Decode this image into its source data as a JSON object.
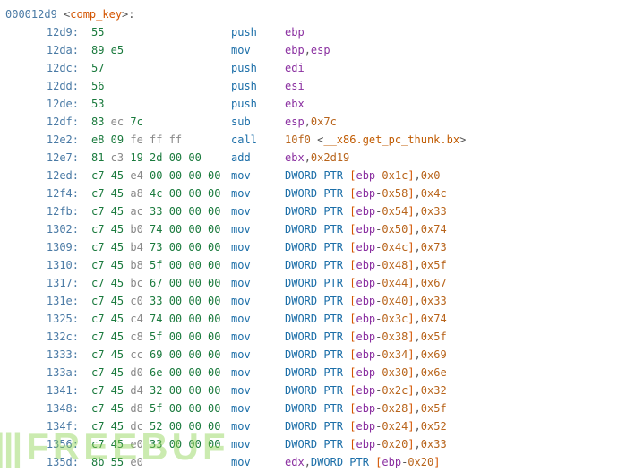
{
  "header": {
    "addr": "000012d9",
    "open": " <",
    "label": "comp_key",
    "close": ">:"
  },
  "rows": [
    {
      "addr": "12d9:",
      "bytes": [
        [
          "55",
          "h"
        ]
      ],
      "mnem": "push",
      "operands": [
        [
          "ebp",
          "reg"
        ]
      ]
    },
    {
      "addr": "12da:",
      "bytes": [
        [
          "89",
          "h"
        ],
        [
          " e5",
          "h"
        ]
      ],
      "mnem": "mov",
      "operands": [
        [
          "ebp",
          "reg"
        ],
        [
          ",",
          "punct"
        ],
        [
          "esp",
          "reg"
        ]
      ]
    },
    {
      "addr": "12dc:",
      "bytes": [
        [
          "57",
          "h"
        ]
      ],
      "mnem": "push",
      "operands": [
        [
          "edi",
          "reg"
        ]
      ]
    },
    {
      "addr": "12dd:",
      "bytes": [
        [
          "56",
          "h"
        ]
      ],
      "mnem": "push",
      "operands": [
        [
          "esi",
          "reg"
        ]
      ]
    },
    {
      "addr": "12de:",
      "bytes": [
        [
          "53",
          "h"
        ]
      ],
      "mnem": "push",
      "operands": [
        [
          "ebx",
          "reg"
        ]
      ]
    },
    {
      "addr": "12df:",
      "bytes": [
        [
          "83",
          "h"
        ],
        [
          " ec ",
          "m"
        ],
        [
          "7c",
          "h"
        ]
      ],
      "mnem": "sub",
      "operands": [
        [
          "esp",
          "reg"
        ],
        [
          ",",
          "punct"
        ],
        [
          "0x7c",
          "num"
        ]
      ]
    },
    {
      "addr": "12e2:",
      "bytes": [
        [
          "e8 09 ",
          "h"
        ],
        [
          "fe ff ff",
          "m"
        ]
      ],
      "mnem": "call",
      "operands": [
        [
          "10f0 ",
          "num"
        ],
        [
          "<",
          "punct"
        ],
        [
          "__x86.get_pc_thunk.bx",
          "str"
        ],
        [
          ">",
          "punct"
        ]
      ]
    },
    {
      "addr": "12e7:",
      "bytes": [
        [
          "81",
          "h"
        ],
        [
          " c3 ",
          "m"
        ],
        [
          "19 2d 00 00",
          "h"
        ]
      ],
      "mnem": "add",
      "operands": [
        [
          "ebx",
          "reg"
        ],
        [
          ",",
          "punct"
        ],
        [
          "0x2d19",
          "num"
        ]
      ]
    },
    {
      "addr": "12ed:",
      "bytes": [
        [
          "c7 45",
          "h"
        ],
        [
          " e4 ",
          "m"
        ],
        [
          "00 00 00 00",
          "h"
        ]
      ],
      "mnem": "mov",
      "operands": [
        [
          "DWORD PTR ",
          "kw"
        ],
        [
          "[",
          "bracket"
        ],
        [
          "ebp",
          "reg"
        ],
        [
          "-",
          "punct"
        ],
        [
          "0x1c",
          "num"
        ],
        [
          "]",
          "bracket"
        ],
        [
          ",",
          "punct"
        ],
        [
          "0x0",
          "num"
        ]
      ]
    },
    {
      "addr": "12f4:",
      "bytes": [
        [
          "c7 45",
          "h"
        ],
        [
          " a8 ",
          "m"
        ],
        [
          "4c 00 00 00",
          "h"
        ]
      ],
      "mnem": "mov",
      "operands": [
        [
          "DWORD PTR ",
          "kw"
        ],
        [
          "[",
          "bracket"
        ],
        [
          "ebp",
          "reg"
        ],
        [
          "-",
          "punct"
        ],
        [
          "0x58",
          "num"
        ],
        [
          "]",
          "bracket"
        ],
        [
          ",",
          "punct"
        ],
        [
          "0x4c",
          "num"
        ]
      ]
    },
    {
      "addr": "12fb:",
      "bytes": [
        [
          "c7 45",
          "h"
        ],
        [
          " ac ",
          "m"
        ],
        [
          "33 00 00 00",
          "h"
        ]
      ],
      "mnem": "mov",
      "operands": [
        [
          "DWORD PTR ",
          "kw"
        ],
        [
          "[",
          "bracket"
        ],
        [
          "ebp",
          "reg"
        ],
        [
          "-",
          "punct"
        ],
        [
          "0x54",
          "num"
        ],
        [
          "]",
          "bracket"
        ],
        [
          ",",
          "punct"
        ],
        [
          "0x33",
          "num"
        ]
      ]
    },
    {
      "addr": "1302:",
      "bytes": [
        [
          "c7 45",
          "h"
        ],
        [
          " b0 ",
          "m"
        ],
        [
          "74 00 00 00",
          "h"
        ]
      ],
      "mnem": "mov",
      "operands": [
        [
          "DWORD PTR ",
          "kw"
        ],
        [
          "[",
          "bracket"
        ],
        [
          "ebp",
          "reg"
        ],
        [
          "-",
          "punct"
        ],
        [
          "0x50",
          "num"
        ],
        [
          "]",
          "bracket"
        ],
        [
          ",",
          "punct"
        ],
        [
          "0x74",
          "num"
        ]
      ]
    },
    {
      "addr": "1309:",
      "bytes": [
        [
          "c7 45",
          "h"
        ],
        [
          " b4 ",
          "m"
        ],
        [
          "73 00 00 00",
          "h"
        ]
      ],
      "mnem": "mov",
      "operands": [
        [
          "DWORD PTR ",
          "kw"
        ],
        [
          "[",
          "bracket"
        ],
        [
          "ebp",
          "reg"
        ],
        [
          "-",
          "punct"
        ],
        [
          "0x4c",
          "num"
        ],
        [
          "]",
          "bracket"
        ],
        [
          ",",
          "punct"
        ],
        [
          "0x73",
          "num"
        ]
      ]
    },
    {
      "addr": "1310:",
      "bytes": [
        [
          "c7 45",
          "h"
        ],
        [
          " b8 ",
          "m"
        ],
        [
          "5f 00 00 00",
          "h"
        ]
      ],
      "mnem": "mov",
      "operands": [
        [
          "DWORD PTR ",
          "kw"
        ],
        [
          "[",
          "bracket"
        ],
        [
          "ebp",
          "reg"
        ],
        [
          "-",
          "punct"
        ],
        [
          "0x48",
          "num"
        ],
        [
          "]",
          "bracket"
        ],
        [
          ",",
          "punct"
        ],
        [
          "0x5f",
          "num"
        ]
      ]
    },
    {
      "addr": "1317:",
      "bytes": [
        [
          "c7 45",
          "h"
        ],
        [
          " bc ",
          "m"
        ],
        [
          "67 00 00 00",
          "h"
        ]
      ],
      "mnem": "mov",
      "operands": [
        [
          "DWORD PTR ",
          "kw"
        ],
        [
          "[",
          "bracket"
        ],
        [
          "ebp",
          "reg"
        ],
        [
          "-",
          "punct"
        ],
        [
          "0x44",
          "num"
        ],
        [
          "]",
          "bracket"
        ],
        [
          ",",
          "punct"
        ],
        [
          "0x67",
          "num"
        ]
      ]
    },
    {
      "addr": "131e:",
      "bytes": [
        [
          "c7 45",
          "h"
        ],
        [
          " c0 ",
          "m"
        ],
        [
          "33 00 00 00",
          "h"
        ]
      ],
      "mnem": "mov",
      "operands": [
        [
          "DWORD PTR ",
          "kw"
        ],
        [
          "[",
          "bracket"
        ],
        [
          "ebp",
          "reg"
        ],
        [
          "-",
          "punct"
        ],
        [
          "0x40",
          "num"
        ],
        [
          "]",
          "bracket"
        ],
        [
          ",",
          "punct"
        ],
        [
          "0x33",
          "num"
        ]
      ]
    },
    {
      "addr": "1325:",
      "bytes": [
        [
          "c7 45",
          "h"
        ],
        [
          " c4 ",
          "m"
        ],
        [
          "74 00 00 00",
          "h"
        ]
      ],
      "mnem": "mov",
      "operands": [
        [
          "DWORD PTR ",
          "kw"
        ],
        [
          "[",
          "bracket"
        ],
        [
          "ebp",
          "reg"
        ],
        [
          "-",
          "punct"
        ],
        [
          "0x3c",
          "num"
        ],
        [
          "]",
          "bracket"
        ],
        [
          ",",
          "punct"
        ],
        [
          "0x74",
          "num"
        ]
      ]
    },
    {
      "addr": "132c:",
      "bytes": [
        [
          "c7 45",
          "h"
        ],
        [
          " c8 ",
          "m"
        ],
        [
          "5f 00 00 00",
          "h"
        ]
      ],
      "mnem": "mov",
      "operands": [
        [
          "DWORD PTR ",
          "kw"
        ],
        [
          "[",
          "bracket"
        ],
        [
          "ebp",
          "reg"
        ],
        [
          "-",
          "punct"
        ],
        [
          "0x38",
          "num"
        ],
        [
          "]",
          "bracket"
        ],
        [
          ",",
          "punct"
        ],
        [
          "0x5f",
          "num"
        ]
      ]
    },
    {
      "addr": "1333:",
      "bytes": [
        [
          "c7 45",
          "h"
        ],
        [
          " cc ",
          "m"
        ],
        [
          "69 00 00 00",
          "h"
        ]
      ],
      "mnem": "mov",
      "operands": [
        [
          "DWORD PTR ",
          "kw"
        ],
        [
          "[",
          "bracket"
        ],
        [
          "ebp",
          "reg"
        ],
        [
          "-",
          "punct"
        ],
        [
          "0x34",
          "num"
        ],
        [
          "]",
          "bracket"
        ],
        [
          ",",
          "punct"
        ],
        [
          "0x69",
          "num"
        ]
      ]
    },
    {
      "addr": "133a:",
      "bytes": [
        [
          "c7 45",
          "h"
        ],
        [
          " d0 ",
          "m"
        ],
        [
          "6e 00 00 00",
          "h"
        ]
      ],
      "mnem": "mov",
      "operands": [
        [
          "DWORD PTR ",
          "kw"
        ],
        [
          "[",
          "bracket"
        ],
        [
          "ebp",
          "reg"
        ],
        [
          "-",
          "punct"
        ],
        [
          "0x30",
          "num"
        ],
        [
          "]",
          "bracket"
        ],
        [
          ",",
          "punct"
        ],
        [
          "0x6e",
          "num"
        ]
      ]
    },
    {
      "addr": "1341:",
      "bytes": [
        [
          "c7 45",
          "h"
        ],
        [
          " d4 ",
          "m"
        ],
        [
          "32 00 00 00",
          "h"
        ]
      ],
      "mnem": "mov",
      "operands": [
        [
          "DWORD PTR ",
          "kw"
        ],
        [
          "[",
          "bracket"
        ],
        [
          "ebp",
          "reg"
        ],
        [
          "-",
          "punct"
        ],
        [
          "0x2c",
          "num"
        ],
        [
          "]",
          "bracket"
        ],
        [
          ",",
          "punct"
        ],
        [
          "0x32",
          "num"
        ]
      ]
    },
    {
      "addr": "1348:",
      "bytes": [
        [
          "c7 45",
          "h"
        ],
        [
          " d8 ",
          "m"
        ],
        [
          "5f 00 00 00",
          "h"
        ]
      ],
      "mnem": "mov",
      "operands": [
        [
          "DWORD PTR ",
          "kw"
        ],
        [
          "[",
          "bracket"
        ],
        [
          "ebp",
          "reg"
        ],
        [
          "-",
          "punct"
        ],
        [
          "0x28",
          "num"
        ],
        [
          "]",
          "bracket"
        ],
        [
          ",",
          "punct"
        ],
        [
          "0x5f",
          "num"
        ]
      ]
    },
    {
      "addr": "134f:",
      "bytes": [
        [
          "c7 45",
          "h"
        ],
        [
          " dc ",
          "m"
        ],
        [
          "52 00 00 00",
          "h"
        ]
      ],
      "mnem": "mov",
      "operands": [
        [
          "DWORD PTR ",
          "kw"
        ],
        [
          "[",
          "bracket"
        ],
        [
          "ebp",
          "reg"
        ],
        [
          "-",
          "punct"
        ],
        [
          "0x24",
          "num"
        ],
        [
          "]",
          "bracket"
        ],
        [
          ",",
          "punct"
        ],
        [
          "0x52",
          "num"
        ]
      ]
    },
    {
      "addr": "1356:",
      "bytes": [
        [
          "c7 45",
          "h"
        ],
        [
          " e0 ",
          "m"
        ],
        [
          "33 00 00 00",
          "h"
        ]
      ],
      "mnem": "mov",
      "operands": [
        [
          "DWORD PTR ",
          "kw"
        ],
        [
          "[",
          "bracket"
        ],
        [
          "ebp",
          "reg"
        ],
        [
          "-",
          "punct"
        ],
        [
          "0x20",
          "num"
        ],
        [
          "]",
          "bracket"
        ],
        [
          ",",
          "punct"
        ],
        [
          "0x33",
          "num"
        ]
      ]
    },
    {
      "addr": "135d:",
      "bytes": [
        [
          "8b 55",
          "h"
        ],
        [
          " e0",
          "m"
        ]
      ],
      "mnem": "mov",
      "operands": [
        [
          "edx",
          "reg"
        ],
        [
          ",",
          "punct"
        ],
        [
          "DWORD PTR ",
          "kw"
        ],
        [
          "[",
          "bracket"
        ],
        [
          "ebp",
          "reg"
        ],
        [
          "-",
          "punct"
        ],
        [
          "0x20",
          "num"
        ],
        [
          "]",
          "bracket"
        ]
      ]
    }
  ],
  "watermark": {
    "bars": "|||",
    "text": "FREEBUF"
  }
}
